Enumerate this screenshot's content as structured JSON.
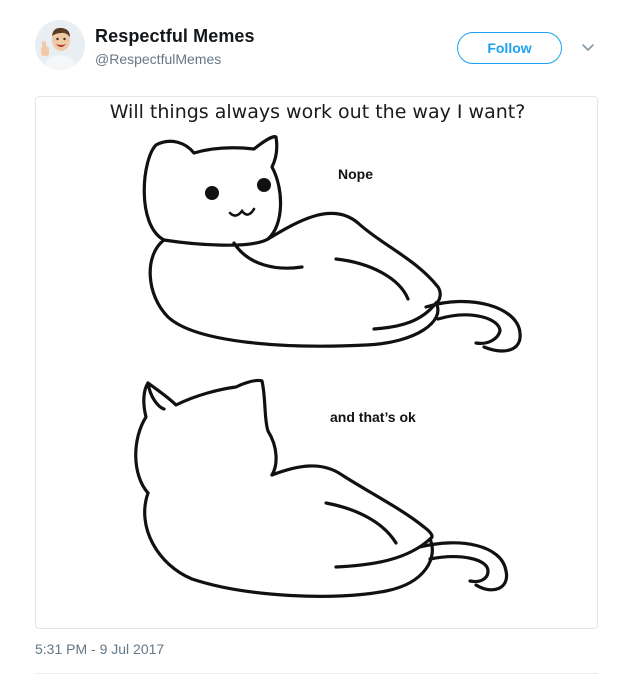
{
  "tweet": {
    "display_name": "Respectful Memes",
    "handle": "@RespectfulMemes",
    "follow_label": "Follow",
    "timestamp": "5:31 PM - 9 Jul 2017"
  },
  "meme": {
    "title": "Will things always work out the way I want?",
    "caption_top": "Nope",
    "caption_bottom": "and that’s ok"
  },
  "icons": {
    "more": "chevron-down-icon",
    "avatar": "avatar-thumbs-up"
  },
  "colors": {
    "accent": "#1da1f2",
    "text_primary": "#14171a",
    "text_secondary": "#657786",
    "border": "#e1e8ed"
  }
}
